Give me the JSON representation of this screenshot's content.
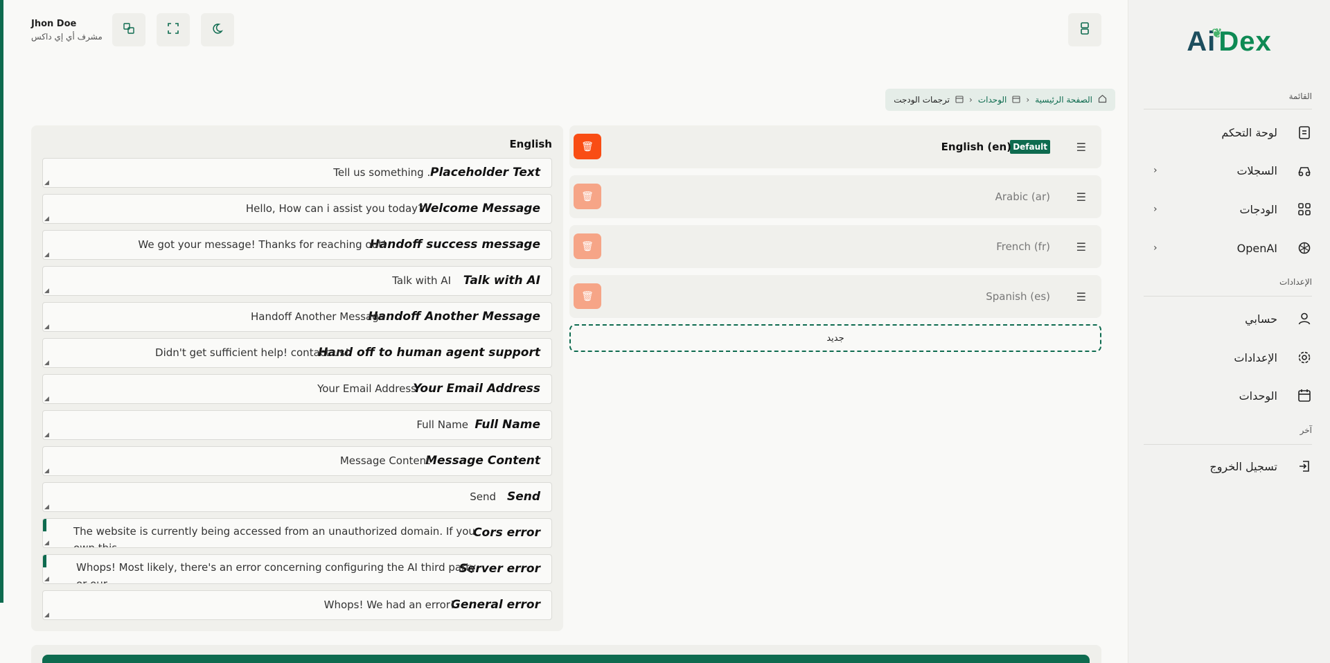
{
  "brand": {
    "logo_left": "Ai",
    "logo_right": "Dex"
  },
  "sidebar": {
    "section_menu": "القائمة",
    "section_settings": "الإعدادات",
    "section_other": "آخر",
    "items": [
      {
        "label": "لوحة التحكم",
        "icon": "clipboard-icon",
        "has_chevron": false
      },
      {
        "label": "السجلات",
        "icon": "records-icon",
        "has_chevron": true
      },
      {
        "label": "الودجات",
        "icon": "grid-icon",
        "has_chevron": true
      },
      {
        "label": "OpenAI",
        "icon": "openai-icon",
        "has_chevron": true
      },
      {
        "label": "حسابي",
        "icon": "user-icon",
        "has_chevron": false
      },
      {
        "label": "الإعدادات",
        "icon": "gear-icon",
        "has_chevron": false
      },
      {
        "label": "الوحدات",
        "icon": "calendar-icon",
        "has_chevron": false
      },
      {
        "label": "تسجيل الخروج",
        "icon": "logout-icon",
        "has_chevron": false
      }
    ]
  },
  "user": {
    "name": "Jhon Doe",
    "role": "مشرف أي إي داكس"
  },
  "breadcrumb": {
    "home": "الصفحة الرئيسية",
    "units": "الوحدات",
    "current": "ترجمات الودجت"
  },
  "languages": [
    {
      "name": "English (en)",
      "badge": "Default",
      "active": true
    },
    {
      "name": "Arabic (ar)",
      "badge": "",
      "active": false
    },
    {
      "name": "French (fr)",
      "badge": "",
      "active": false
    },
    {
      "name": "Spanish (es)",
      "badge": "",
      "active": false
    }
  ],
  "new_button": "جديد",
  "panel": {
    "title": "English",
    "fields": [
      {
        "label": "Placeholder Text",
        "value": "Tell us something ..",
        "multi": false
      },
      {
        "label": "Welcome Message",
        "value": "Hello, How can i assist you today?",
        "multi": false
      },
      {
        "label": "Handoff success message",
        "value": "We got your message! Thanks for reaching out!",
        "multi": false
      },
      {
        "label": "Talk with AI",
        "value": "Talk with AI",
        "multi": false
      },
      {
        "label": "Handoff Another Message",
        "value": "Handoff Another Message",
        "multi": false
      },
      {
        "label": "Hand off to human agent support",
        "value": "Didn't get sufficient help! contact us!",
        "multi": false
      },
      {
        "label": "Your Email Address",
        "value": "Your Email Address",
        "multi": false
      },
      {
        "label": "Full Name",
        "value": "Full Name",
        "multi": false
      },
      {
        "label": "Message Content",
        "value": "Message Content",
        "multi": false
      },
      {
        "label": "Send",
        "value": "Send",
        "multi": false
      },
      {
        "label": "Cors error",
        "value": "The website is currently being accessed from an unauthorized domain. If you own this",
        "multi": true
      },
      {
        "label": "Server error",
        "value": "Whops! Most likely, there's an error concerning configuring the AI third party or our",
        "multi": true
      },
      {
        "label": "General error",
        "value": "Whops! We had an error!",
        "multi": false
      }
    ]
  },
  "colors": {
    "accent": "#0e6b4f",
    "danger": "#f94d14",
    "danger_light": "#f6a587"
  }
}
